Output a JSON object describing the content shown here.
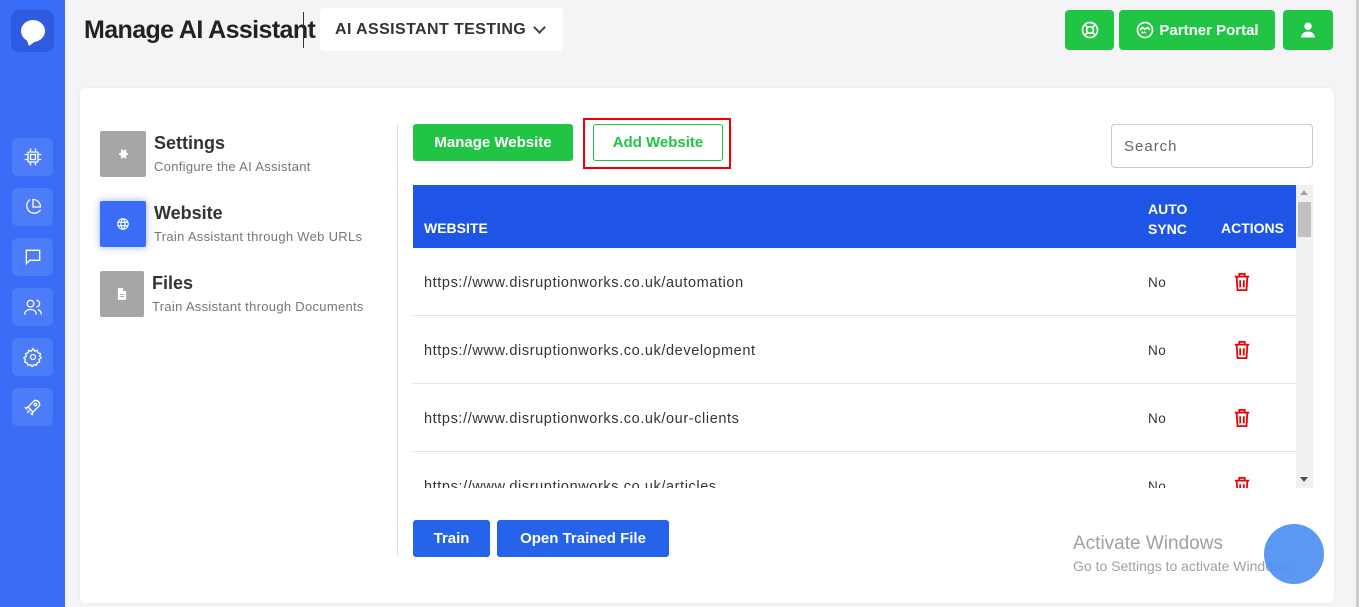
{
  "header": {
    "title": "Manage AI Assistant",
    "assistant_select": "AI ASSISTANT TESTING",
    "partner_portal_label": "Partner Portal"
  },
  "rail": {
    "icons": [
      "chat-bubble-icon",
      "cpu-icon",
      "pie-chart-icon",
      "message-icon",
      "users-icon",
      "gear-icon",
      "rocket-icon"
    ]
  },
  "menu": [
    {
      "title": "Settings",
      "subtitle": "Configure the AI Assistant",
      "icon": "gear-icon"
    },
    {
      "title": "Website",
      "subtitle": "Train Assistant through Web URLs",
      "icon": "globe-icon"
    },
    {
      "title": "Files",
      "subtitle": "Train Assistant through Documents",
      "icon": "document-icon"
    }
  ],
  "toolbar": {
    "manage_label": "Manage Website",
    "add_label": "Add Website",
    "search_placeholder": "Search"
  },
  "table": {
    "headers": {
      "website": "WEBSITE",
      "auto_sync_1": "AUTO",
      "auto_sync_2": "SYNC",
      "actions": "ACTIONS"
    },
    "rows": [
      {
        "url": "https://www.disruptionworks.co.uk/automation",
        "sync": "No"
      },
      {
        "url": "https://www.disruptionworks.co.uk/development",
        "sync": "No"
      },
      {
        "url": "https://www.disruptionworks.co.uk/our-clients",
        "sync": "No"
      },
      {
        "url": "https://www.disruptionworks.co.uk/articles",
        "sync": "No"
      }
    ]
  },
  "actions": {
    "train_label": "Train",
    "open_label": "Open Trained File"
  },
  "watermark": {
    "line1": "Activate Windows",
    "line2": "Go to Settings to activate Windows."
  },
  "colors": {
    "rail": "#3b6cf6",
    "green": "#22c445",
    "table_header": "#1f55e6",
    "delete": "#ee0000"
  }
}
